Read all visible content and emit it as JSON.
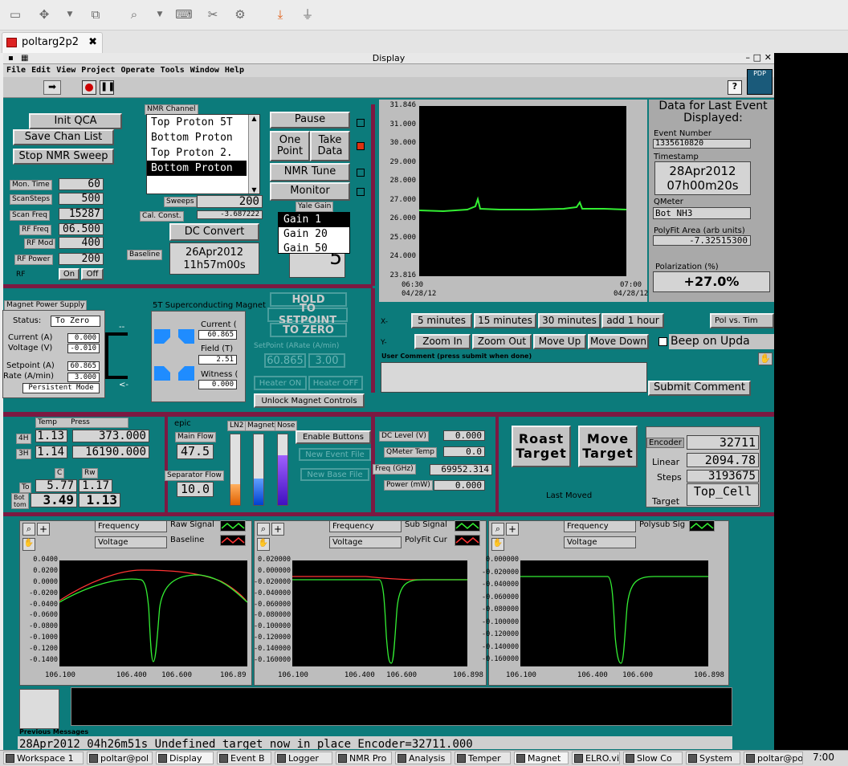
{
  "os": {
    "tab_title": "poltarg2p2"
  },
  "window": {
    "title": "Display",
    "menu": "File Edit View Project Operate Tools Window Help"
  },
  "nmr": {
    "init_qca": "Init QCA",
    "save_chan": "Save Chan List",
    "stop_sweep": "Stop NMR Sweep",
    "channel_label": "NMR Channel",
    "channels": [
      "Top Proton 5T",
      "Bottom Proton",
      "Top Proton 2.",
      "Bottom Proton"
    ],
    "pause": "Pause",
    "one_point": "One Point",
    "take_data": "Take Data",
    "nmr_tune": "NMR Tune",
    "monitor": "Monitor",
    "sweeps_lbl": "Sweeps",
    "sweeps": "200",
    "cal_lbl": "Cal. Const.",
    "cal": "-3.687222",
    "yale_gain": "Yale Gain",
    "gain_opts": [
      "Gain 1",
      "Gain 20",
      "Gain 50"
    ],
    "gain_value": "5",
    "dc_convert": "DC Convert",
    "baseline_lbl": "Baseline",
    "baseline_date": "26Apr2012",
    "baseline_time": "11h57m00s",
    "params": [
      {
        "label": "Mon. Time",
        "value": "60"
      },
      {
        "label": "ScanSteps",
        "value": "500"
      },
      {
        "label": "Scan Freq",
        "value": "15287"
      },
      {
        "label": "RF Freq",
        "value": "06.500"
      },
      {
        "label": "RF Mod",
        "value": "400"
      },
      {
        "label": "RF Power",
        "value": "200"
      }
    ],
    "rf_lbl": "RF",
    "rf_on": "On",
    "rf_off": "Off"
  },
  "chart_main": {
    "y_ticks": [
      "31.846",
      "31.000",
      "30.000",
      "29.000",
      "28.000",
      "27.000",
      "26.000",
      "25.000",
      "24.000",
      "23.816"
    ],
    "x_left": "06:30",
    "x_left2": "04/28/12",
    "x_right": "07:00",
    "x_right2": "04/28/12"
  },
  "last_event": {
    "title": "Data for Last Event Displayed:",
    "event_lbl": "Event Number",
    "event": "1335610820",
    "ts_lbl": "Timestamp",
    "date": "28Apr2012",
    "time": "07h00m20s",
    "qmeter_lbl": "QMeter",
    "qmeter": "Bot NH3",
    "area_lbl": "PolyFit Area (arb units)",
    "area": "-7.32515300",
    "pol_lbl": "Polarization (%)",
    "pol": "+27.0%"
  },
  "magnet": {
    "title": "Magnet Power Supply",
    "status_lbl": "Status:",
    "status": "To Zero",
    "current_lbl": "Current (A)",
    "current": "0.000",
    "voltage_lbl": "Voltage (V)",
    "voltage": "-0.010",
    "setpoint_lbl": "Setpoint (A)",
    "setpoint": "60.865",
    "rate_lbl": "Rate (A/min)",
    "rate": "3.000",
    "mode": "Persistent Mode",
    "sc_title": "5T Superconducting Magnet",
    "sc_current_lbl": "Current (",
    "sc_current": "60.865",
    "field_lbl": "Field (T)",
    "field": "2.51",
    "witness_lbl": "Witness (",
    "witness": "0.000",
    "hold": "HOLD",
    "to_setpoint": "TO SETPOINT",
    "to_zero": "TO ZERO",
    "setpoint_rate_lbl": "SetPoint (ARate (A/min)",
    "sp_val": "60.865",
    "rate_val": "3.00",
    "heater_on": "Heater ON",
    "heater_off": "Heater OFF",
    "unlock": "Unlock Magnet Controls"
  },
  "chart_ctrl": {
    "x_lbl": "X-",
    "y_lbl": "Y-",
    "x_btns": [
      "5 minutes",
      "15 minutes",
      "30 minutes",
      "add 1 hour"
    ],
    "y_btns": [
      "Zoom In",
      "Zoom Out",
      "Move Up",
      "Move Down"
    ],
    "pol_vs": "Pol vs. Tim",
    "beep": "Beep on Upda",
    "comment_lbl": "User Comment (press submit when done)",
    "submit": "Submit Comment"
  },
  "temps": {
    "temp_lbl": "Temp",
    "press_lbl": "Press",
    "rows": [
      {
        "lbl": "4H",
        "temp": "1.13",
        "press": "373.000"
      },
      {
        "lbl": "3H",
        "temp": "1.14",
        "press": "16190.000"
      }
    ],
    "c_lbl": "C",
    "rw_lbl": "Rw",
    "to_lbl": "To",
    "c_to": "5.77",
    "rw_to": "1.17",
    "bot_lbl": "Bot tom",
    "c_bot": "3.49",
    "rw_bot": "1.13"
  },
  "epic": {
    "title": "epic",
    "main_flow_lbl": "Main Flow",
    "main_flow": "47.5",
    "sep_flow_lbl": "Separator Flow",
    "sep_flow": "10.0",
    "ln2_lbl": "LN2",
    "magnet_lbl": "Magnet",
    "nose_lbl": "Nose",
    "ln2_level": 0.3,
    "magnet_level": 0.37,
    "nose_level": 0.71,
    "enable": "Enable Buttons",
    "new_event": "New Event File",
    "new_base": "New Base File"
  },
  "dc": {
    "level_lbl": "DC Level (V)",
    "level": "0.000",
    "qtemp_lbl": "QMeter Temp",
    "qtemp": "0.0",
    "freq_lbl": "Freq (GHz)",
    "freq": "69952.314",
    "power_lbl": "Power (mW)",
    "power": "0.000"
  },
  "target": {
    "roast": "Roast Target",
    "move": "Move Target",
    "last_moved": "Last Moved",
    "encoder_lbl": "Encoder",
    "encoder": "32711",
    "linear_lbl": "Linear",
    "linear": "2094.78",
    "steps_lbl": "Steps",
    "steps": "3193675",
    "target_lbl": "Target",
    "target": "Top_Cell"
  },
  "graphs": [
    {
      "freq_lbl": "Frequency",
      "volt_lbl": "Voltage",
      "legend1": "Raw Signal",
      "legend2": "Baseline",
      "y_ticks": [
        "0.0400",
        "0.0200",
        "0.0000",
        "-0.0200",
        "-0.0400",
        "-0.0600",
        "-0.0800",
        "-0.1000",
        "-0.1200",
        "-0.1400"
      ],
      "x_ticks": [
        "106.100",
        "106.400",
        "106.600",
        "106.89"
      ]
    },
    {
      "freq_lbl": "Frequency",
      "volt_lbl": "Voltage",
      "legend1": "Sub Signal",
      "legend2": "PolyFit Cur",
      "y_ticks": [
        "0.020000",
        "0.000000",
        "-0.020000",
        "-0.040000",
        "-0.060000",
        "-0.080000",
        "-0.100000",
        "-0.120000",
        "-0.140000",
        "-0.160000"
      ],
      "x_ticks": [
        "106.100",
        "106.400",
        "106.600",
        "106.898"
      ]
    },
    {
      "freq_lbl": "Frequency",
      "volt_lbl": "Voltage",
      "legend1": "Polysub Sig",
      "legend2": "",
      "y_ticks": [
        "0.000000",
        "-0.020000",
        "-0.040000",
        "-0.060000",
        "-0.080000",
        "-0.100000",
        "-0.120000",
        "-0.140000",
        "-0.160000"
      ],
      "x_ticks": [
        "106.100",
        "106.400",
        "106.600",
        "106.898"
      ]
    }
  ],
  "messages": {
    "lbl": "Previous Messages",
    "text": "28Apr2012 04h26m51s Undefined target now in place    Encoder=32711.000"
  },
  "taskbar": {
    "items": [
      "Workspace 1",
      "poltar@pol",
      "Display",
      "Event B",
      "Logger",
      "NMR Pro",
      "Analysis",
      "Temper",
      "Magnet",
      "ELRO.vi",
      "Slow Co",
      "System",
      "poltar@po"
    ],
    "clock": "7:00"
  },
  "colors": {
    "panel": "#0c7b7b",
    "maroon": "#7c1942",
    "trace_green": "#33ee33",
    "trace_red": "#ff3333"
  }
}
